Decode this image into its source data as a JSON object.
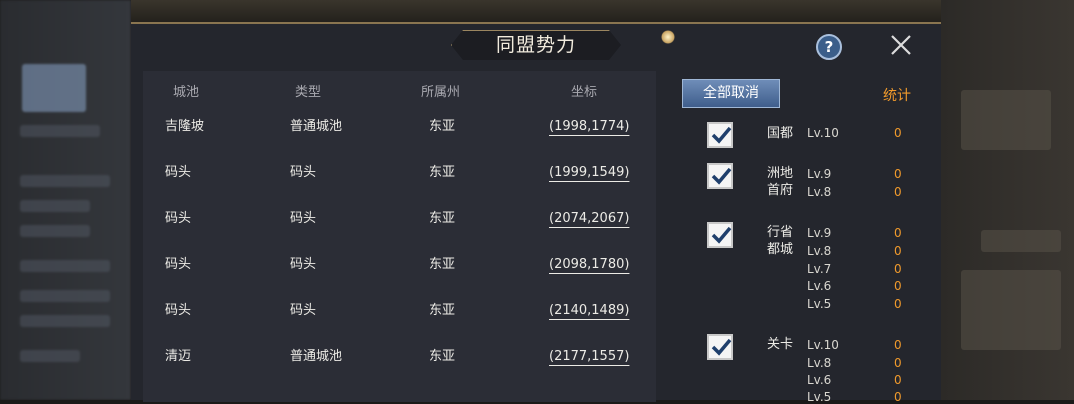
{
  "dialog": {
    "title": "同盟势力",
    "help_glyph": "?",
    "close_glyph": "✕"
  },
  "table": {
    "headers": [
      "城池",
      "类型",
      "所属州",
      "坐标"
    ],
    "rows": [
      {
        "city": "吉隆坡",
        "type": "普通城池",
        "region": "东亚",
        "coord": "(1998,1774)"
      },
      {
        "city": "码头",
        "type": "码头",
        "region": "东亚",
        "coord": "(1999,1549)"
      },
      {
        "city": "码头",
        "type": "码头",
        "region": "东亚",
        "coord": "(2074,2067)"
      },
      {
        "city": "码头",
        "type": "码头",
        "region": "东亚",
        "coord": "(2098,1780)"
      },
      {
        "city": "码头",
        "type": "码头",
        "region": "东亚",
        "coord": "(2140,1489)"
      },
      {
        "city": "清迈",
        "type": "普通城池",
        "region": "东亚",
        "coord": "(2177,1557)"
      }
    ]
  },
  "filter": {
    "cancel_all_label": "全部取消",
    "stats_label": "统计",
    "groups": [
      {
        "name": "国都",
        "checked": true,
        "levels": [
          {
            "lv": "Lv.10",
            "count": "0"
          }
        ]
      },
      {
        "name": "洲地首府",
        "checked": true,
        "levels": [
          {
            "lv": "Lv.9",
            "count": "0"
          },
          {
            "lv": "Lv.8",
            "count": "0"
          }
        ]
      },
      {
        "name": "行省都城",
        "checked": true,
        "levels": [
          {
            "lv": "Lv.9",
            "count": "0"
          },
          {
            "lv": "Lv.8",
            "count": "0"
          },
          {
            "lv": "Lv.7",
            "count": "0"
          },
          {
            "lv": "Lv.6",
            "count": "0"
          },
          {
            "lv": "Lv.5",
            "count": "0"
          }
        ]
      },
      {
        "name": "关卡",
        "checked": true,
        "levels": [
          {
            "lv": "Lv.10",
            "count": "0"
          },
          {
            "lv": "Lv.8",
            "count": "0"
          },
          {
            "lv": "Lv.6",
            "count": "0"
          },
          {
            "lv": "Lv.5",
            "count": "0"
          }
        ]
      }
    ]
  },
  "colors": {
    "accent": "#f09a2c",
    "button": "#4f6f9f",
    "panel": "#2b2d36"
  }
}
